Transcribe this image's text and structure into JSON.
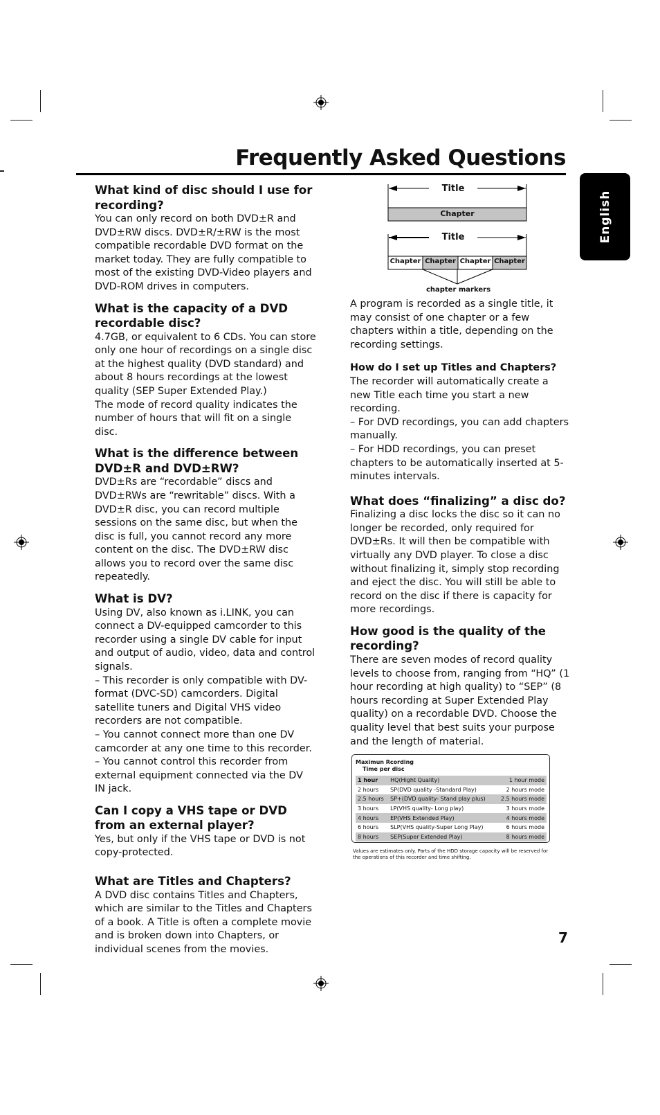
{
  "page": {
    "title": "Frequently Asked Questions",
    "language_tab": "English",
    "page_number": "7"
  },
  "left_column": [
    {
      "question": "What kind of disc should I use for recording?",
      "answer": "You can only record on both DVD±R and DVD±RW discs. DVD±R/±RW is the most compatible recordable DVD format on the market today. They are fully compatible to most of the existing DVD-Video players and DVD-ROM drives in computers."
    },
    {
      "question": "What is the capacity of a DVD recordable disc?",
      "answer": "4.7GB, or equivalent to 6 CDs. You can store only one hour of recordings on a single disc at the highest quality (DVD standard) and about 8 hours recordings at the lowest quality (SEP Super Extended  Play.)\nThe mode of record quality indicates the number of hours that will fit on a single disc."
    },
    {
      "question": "What is the difference between DVD±R and DVD±RW?",
      "answer": "DVD±Rs are “recordable” discs and DVD±RWs are “rewritable” discs. With a DVD±R disc, you can record multiple sessions on the same disc, but when the disc is full, you cannot record any more content on the disc. The DVD±RW disc allows you to record over the same disc repeatedly."
    },
    {
      "question": "What is DV?",
      "answer": "Using DV, also known as i.LINK, you can connect a DV-equipped camcorder to this recorder using a single DV cable for input and output of audio, video, data and control signals.\n–   This recorder is only compatible with DV-format (DVC-SD) camcorders. Digital satellite tuners and Digital VHS video recorders are not compatible.\n–   You cannot connect more than one DV camcorder at any one time to this recorder.\n–   You cannot control this recorder from external equipment connected via the DV IN jack."
    },
    {
      "question": "Can I copy a VHS tape or DVD from an external player?",
      "answer": "Yes, but only if the VHS tape or DVD is not copy-protected."
    },
    {
      "question": "What are Titles and Chapters?",
      "answer": "A DVD disc contains Titles and Chapters, which are similar to the Titles and Chapters of a book. A Title is often a complete movie and is broken down into Chapters, or individual scenes from the movies."
    }
  ],
  "diagram": {
    "title_label_top": "Title",
    "chapter_label_single": "Chapter",
    "title_label_bottom": "Title",
    "chapters": [
      "Chapter",
      "Chapter",
      "Chapter",
      "Chapter"
    ],
    "markers_label": "chapter markers"
  },
  "right_column": {
    "intro": "A program is recorded as a single title, it may consist of one chapter or a few chapters within a title, depending on the recording settings.",
    "faqs": [
      {
        "question": "How do I set up Titles and Chapters?",
        "answer": "The recorder will automatically create a new Title each time you start a new recording.\n–   For DVD recordings, you can add chapters manually.\n–   For HDD recordings, you can preset chapters to be automatically inserted at 5-minutes intervals."
      },
      {
        "question": "What does “finalizing” a disc do?",
        "answer": "Finalizing a disc locks the disc so it can no longer be recorded, only required for DVD±Rs. It will then be compatible with virtually any DVD player. To close a disc without finalizing it, simply stop recording and eject the disc. You will still be able to record on the disc if there is capacity for more recordings."
      },
      {
        "question": "How good is the quality of the recording?",
        "answer": "There are seven modes of record quality levels to choose from, ranging from “HQ” (1 hour recording at high quality) to “SEP” (8 hours recording at Super Extended Play quality) on a recordable DVD. Choose the quality level that best suits your purpose and the length of material."
      }
    ]
  },
  "recording_table": {
    "header_line1": "Maximun Rcording",
    "header_line2": "Time per disc",
    "rows": [
      [
        "1 hour",
        "HQ(Hight Quality)",
        "1 hour mode"
      ],
      [
        "2 hours",
        "SP(DVD quality -Standard Play)",
        "2 hours mode"
      ],
      [
        "2.5 hours",
        "SP+(DVD quality- Stand play plus)",
        "2.5 hours mode"
      ],
      [
        "3 hours",
        "LP(VHS quality- Long play)",
        "3 hours mode"
      ],
      [
        "4 hours",
        "EP(VHS Extended Play)",
        "4 hours mode"
      ],
      [
        "6 hours",
        "SLP(VHS quality-Super Long Play)",
        "6 hours mode"
      ],
      [
        "8 hours",
        "SEP(Super Extended Play)",
        "8 hours mode"
      ]
    ],
    "note": "Values are estimates only. Parts of the HDD storage capacity will be reserved for the operations of this recorder and time shifting."
  },
  "colors": {
    "text": "#111111",
    "tab_bg": "#000000",
    "shade": "#c8c8c8"
  }
}
